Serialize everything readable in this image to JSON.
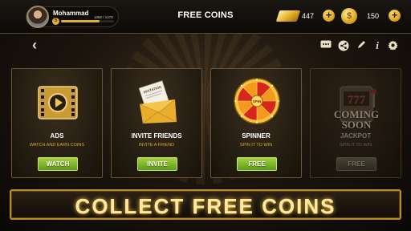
{
  "header": {
    "player_name": "Mohammad",
    "level": "5",
    "xp_text": "1080 / 1470",
    "xp_progress": 0.73,
    "title": "FREE COINS",
    "gold": "447",
    "coins": "150",
    "coin_symbol": "$",
    "plus": "+"
  },
  "toolbar": {
    "back_glyph": "‹",
    "icons": [
      "ticket-icon",
      "share-icon",
      "pencil-icon",
      "info-icon",
      "gear-icon"
    ]
  },
  "cards": [
    {
      "title": "ADS",
      "subtitle": "WATCH AND EARN COINS",
      "button": "WATCH",
      "icon": "film-play-icon"
    },
    {
      "title": "INVITE FRIENDS",
      "subtitle": "INVITE A FRIEND",
      "button": "INVITE",
      "icon": "invitation-envelope-icon",
      "icon_text": "INVITATION"
    },
    {
      "title": "SPINNER",
      "subtitle": "SPIN IT TO WIN",
      "button": "FREE",
      "icon": "prize-wheel-icon",
      "icon_text": "SPIN"
    },
    {
      "title": "JACKPOT",
      "subtitle": "SPIN IT TO WIN",
      "button": "FREE",
      "icon": "slot-machine-icon",
      "overlay": "COMING SOON",
      "reels": "777"
    }
  ],
  "banner": {
    "text": "COLLECT FREE COINS"
  },
  "colors": {
    "gold": "#e0b030",
    "button_green": "#7cbc2a",
    "frame": "#b88a2a"
  }
}
